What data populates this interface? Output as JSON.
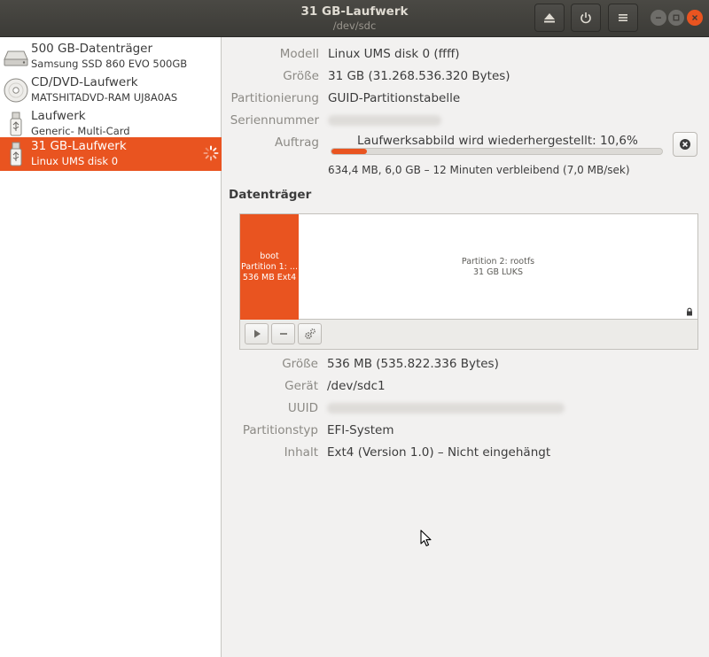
{
  "window": {
    "title": "31 GB-Laufwerk",
    "subtitle": "/dev/sdc"
  },
  "header_buttons": [
    {
      "icon": "eject-icon"
    },
    {
      "icon": "power-icon"
    },
    {
      "icon": "menu-icon"
    }
  ],
  "sidebar": {
    "drives": [
      {
        "name": "500 GB-Datenträger",
        "model": "Samsung SSD 860 EVO 500GB",
        "icon": "hard-disk-icon",
        "selected": false
      },
      {
        "name": "CD/DVD-Laufwerk",
        "model": "MATSHITADVD-RAM UJ8A0AS",
        "icon": "optical-disc-icon",
        "selected": false
      },
      {
        "name": "Laufwerk",
        "model": "Generic- Multi-Card",
        "icon": "usb-drive-icon",
        "selected": false
      },
      {
        "name": "31 GB-Laufwerk",
        "model": "Linux UMS disk 0",
        "icon": "usb-drive-icon",
        "selected": true,
        "busy": true
      }
    ]
  },
  "drive_info": {
    "model_label": "Modell",
    "model_value": "Linux UMS disk 0 (ffff)",
    "size_label": "Größe",
    "size_value": "31 GB (31.268.536.320 Bytes)",
    "partitioning_label": "Partitionierung",
    "partitioning_value": "GUID-Partitionstabelle",
    "serial_label": "Seriennummer",
    "job_label": "Auftrag",
    "job_text": "Laufwerksabbild wird wiederhergestellt: 10,6%",
    "job_progress_fraction": 0.106,
    "job_detail": "634,4 MB, 6,0 GB – 12 Minuten verbleibend (7,0 MB/sek)"
  },
  "volumes": {
    "title": "Datenträger",
    "partitions": [
      {
        "line1": "boot",
        "line2": "Partition 1: ...",
        "line3": "536 MB Ext4"
      },
      {
        "line1": "Partition 2: rootfs",
        "line2": "31 GB LUKS"
      }
    ]
  },
  "volume_toolbar": [
    {
      "icon": "play-icon"
    },
    {
      "icon": "minus-icon"
    },
    {
      "icon": "gears-icon"
    }
  ],
  "partition_info": {
    "size_label": "Größe",
    "size_value": "536 MB (535.822.336 Bytes)",
    "device_label": "Gerät",
    "device_value": "/dev/sdc1",
    "uuid_label": "UUID",
    "type_label": "Partitionstyp",
    "type_value": "EFI-System",
    "contents_label": "Inhalt",
    "contents_value": "Ext4 (Version 1.0) – Nicht eingehängt"
  },
  "colors": {
    "accent": "#e95420",
    "titlebar": "#3c3b37"
  }
}
